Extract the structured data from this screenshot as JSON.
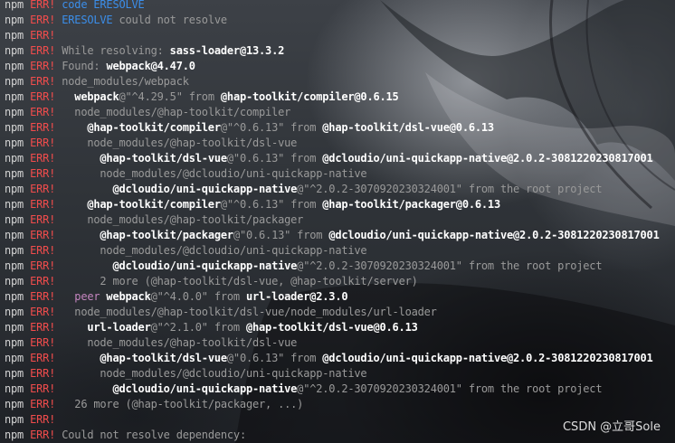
{
  "terminal": {
    "lines": [
      {
        "indent": 0,
        "parts": [
          {
            "t": "code ERESOLVE",
            "c": "kw"
          }
        ]
      },
      {
        "indent": 0,
        "parts": [
          {
            "t": "ERESOLVE",
            "c": "kw"
          },
          {
            "t": " could not resolve",
            "c": "d"
          }
        ]
      },
      {
        "indent": 0,
        "parts": []
      },
      {
        "indent": 0,
        "parts": [
          {
            "t": "While resolving: ",
            "c": "d"
          },
          {
            "t": "sass-loader@13.3.2",
            "c": "b"
          }
        ]
      },
      {
        "indent": 0,
        "parts": [
          {
            "t": "Found: ",
            "c": "d"
          },
          {
            "t": "webpack@4.47.0",
            "c": "b"
          }
        ]
      },
      {
        "indent": 0,
        "parts": [
          {
            "t": "node_modules/webpack",
            "c": "d"
          }
        ]
      },
      {
        "indent": 2,
        "parts": [
          {
            "t": "webpack",
            "c": "b"
          },
          {
            "t": "@\"^4.29.5\" from ",
            "c": "d"
          },
          {
            "t": "@hap-toolkit/compiler@0.6.15",
            "c": "b"
          }
        ]
      },
      {
        "indent": 2,
        "parts": [
          {
            "t": "node_modules/@hap-toolkit/compiler",
            "c": "d"
          }
        ]
      },
      {
        "indent": 4,
        "parts": [
          {
            "t": "@hap-toolkit/compiler",
            "c": "b"
          },
          {
            "t": "@\"^0.6.13\" from ",
            "c": "d"
          },
          {
            "t": "@hap-toolkit/dsl-vue@0.6.13",
            "c": "b"
          }
        ]
      },
      {
        "indent": 4,
        "parts": [
          {
            "t": "node_modules/@hap-toolkit/dsl-vue",
            "c": "d"
          }
        ]
      },
      {
        "indent": 6,
        "parts": [
          {
            "t": "@hap-toolkit/dsl-vue",
            "c": "b"
          },
          {
            "t": "@\"0.6.13\" from ",
            "c": "d"
          },
          {
            "t": "@dcloudio/uni-quickapp-native@2.0.2-3081220230817001",
            "c": "b"
          }
        ]
      },
      {
        "indent": 6,
        "parts": [
          {
            "t": "node_modules/@dcloudio/uni-quickapp-native",
            "c": "d"
          }
        ]
      },
      {
        "indent": 8,
        "parts": [
          {
            "t": "@dcloudio/uni-quickapp-native",
            "c": "b"
          },
          {
            "t": "@\"^2.0.2-3070920230324001\" from the root project",
            "c": "d"
          }
        ]
      },
      {
        "indent": 4,
        "parts": [
          {
            "t": "@hap-toolkit/compiler",
            "c": "b"
          },
          {
            "t": "@\"^0.6.13\" from ",
            "c": "d"
          },
          {
            "t": "@hap-toolkit/packager@0.6.13",
            "c": "b"
          }
        ]
      },
      {
        "indent": 4,
        "parts": [
          {
            "t": "node_modules/@hap-toolkit/packager",
            "c": "d"
          }
        ]
      },
      {
        "indent": 6,
        "parts": [
          {
            "t": "@hap-toolkit/packager",
            "c": "b"
          },
          {
            "t": "@\"0.6.13\" from ",
            "c": "d"
          },
          {
            "t": "@dcloudio/uni-quickapp-native@2.0.2-3081220230817001",
            "c": "b"
          }
        ]
      },
      {
        "indent": 6,
        "parts": [
          {
            "t": "node_modules/@dcloudio/uni-quickapp-native",
            "c": "d"
          }
        ]
      },
      {
        "indent": 8,
        "parts": [
          {
            "t": "@dcloudio/uni-quickapp-native",
            "c": "b"
          },
          {
            "t": "@\"^2.0.2-3070920230324001\" from the root project",
            "c": "d"
          }
        ]
      },
      {
        "indent": 6,
        "parts": [
          {
            "t": "2 more (@hap-toolkit/dsl-vue, @hap-toolkit/server)",
            "c": "d"
          }
        ]
      },
      {
        "indent": 2,
        "parts": [
          {
            "t": "peer ",
            "c": "pe"
          },
          {
            "t": "webpack",
            "c": "b"
          },
          {
            "t": "@\"^4.0.0\" from ",
            "c": "d"
          },
          {
            "t": "url-loader@2.3.0",
            "c": "b"
          }
        ]
      },
      {
        "indent": 2,
        "parts": [
          {
            "t": "node_modules/@hap-toolkit/dsl-vue/node_modules/url-loader",
            "c": "d"
          }
        ]
      },
      {
        "indent": 4,
        "parts": [
          {
            "t": "url-loader",
            "c": "b"
          },
          {
            "t": "@\"^2.1.0\" from ",
            "c": "d"
          },
          {
            "t": "@hap-toolkit/dsl-vue@0.6.13",
            "c": "b"
          }
        ]
      },
      {
        "indent": 4,
        "parts": [
          {
            "t": "node_modules/@hap-toolkit/dsl-vue",
            "c": "d"
          }
        ]
      },
      {
        "indent": 6,
        "parts": [
          {
            "t": "@hap-toolkit/dsl-vue",
            "c": "b"
          },
          {
            "t": "@\"0.6.13\" from ",
            "c": "d"
          },
          {
            "t": "@dcloudio/uni-quickapp-native@2.0.2-3081220230817001",
            "c": "b"
          }
        ]
      },
      {
        "indent": 6,
        "parts": [
          {
            "t": "node_modules/@dcloudio/uni-quickapp-native",
            "c": "d"
          }
        ]
      },
      {
        "indent": 8,
        "parts": [
          {
            "t": "@dcloudio/uni-quickapp-native",
            "c": "b"
          },
          {
            "t": "@\"^2.0.2-3070920230324001\" from the root project",
            "c": "d"
          }
        ]
      },
      {
        "indent": 2,
        "parts": [
          {
            "t": "26 more (@hap-toolkit/packager, ...)",
            "c": "d"
          }
        ]
      },
      {
        "indent": 0,
        "parts": []
      },
      {
        "indent": 0,
        "parts": [
          {
            "t": "Could not resolve dependency:",
            "c": "d"
          }
        ]
      }
    ],
    "prefix_npm": "npm",
    "prefix_err": "ERR!"
  },
  "watermark": "CSDN @立哥Sole",
  "colors": {
    "npm": "#d4d4d4",
    "err": "#f14c4c",
    "keyword": "#3b8eea",
    "bold": "#ffffff",
    "dim": "#9a9a9a",
    "peer": "#c586c0"
  }
}
